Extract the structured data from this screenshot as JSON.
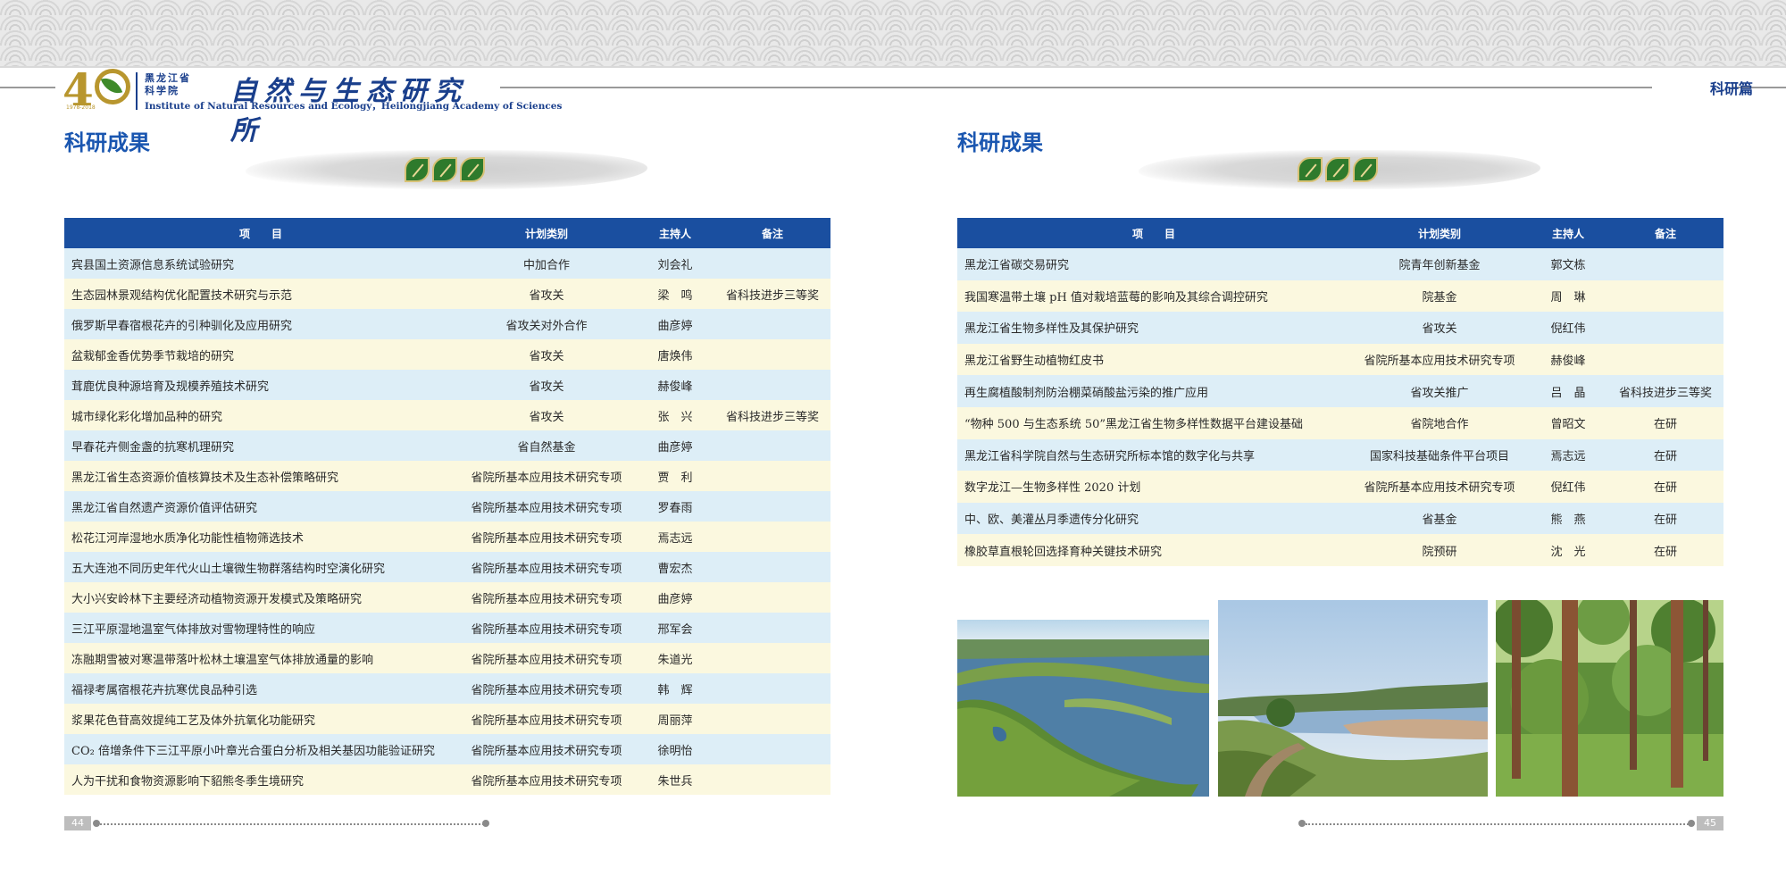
{
  "header": {
    "logo_years": "1978-2018",
    "logo_cn_small": "黑龙江省 科学院",
    "logo_calligraphy": "自然与生态研究所",
    "logo_en": "Institute of Natural Resources and Ecology，Heilongjiang Academy of Sciences",
    "section_tag": "科研篇"
  },
  "left_page": {
    "title": "科研成果",
    "columns": [
      "项　　目",
      "计划类别",
      "主持人",
      "备注"
    ],
    "rows": [
      {
        "project": "宾县国土资源信息系统试验研究",
        "category": "中加合作",
        "leader": "刘会礼",
        "note": ""
      },
      {
        "project": "生态园林景观结构优化配置技术研究与示范",
        "category": "省攻关",
        "leader": "梁　鸣",
        "note": "省科技进步三等奖"
      },
      {
        "project": "俄罗斯早春宿根花卉的引种驯化及应用研究",
        "category": "省攻关对外合作",
        "leader": "曲彦婷",
        "note": ""
      },
      {
        "project": "盆栽郁金香优势季节栽培的研究",
        "category": "省攻关",
        "leader": "唐焕伟",
        "note": ""
      },
      {
        "project": "茸鹿优良种源培育及规模养殖技术研究",
        "category": "省攻关",
        "leader": "赫俊峰",
        "note": ""
      },
      {
        "project": "城市绿化彩化增加品种的研究",
        "category": "省攻关",
        "leader": "张　兴",
        "note": "省科技进步三等奖"
      },
      {
        "project": "早春花卉侧金盏的抗寒机理研究",
        "category": "省自然基金",
        "leader": "曲彦婷",
        "note": ""
      },
      {
        "project": "黑龙江省生态资源价值核算技术及生态补偿策略研究",
        "category": "省院所基本应用技术研究专项",
        "leader": "贾　利",
        "note": ""
      },
      {
        "project": "黑龙江省自然遗产资源价值评估研究",
        "category": "省院所基本应用技术研究专项",
        "leader": "罗春雨",
        "note": ""
      },
      {
        "project": "松花江河岸湿地水质净化功能性植物筛选技术",
        "category": "省院所基本应用技术研究专项",
        "leader": "焉志远",
        "note": ""
      },
      {
        "project": "五大连池不同历史年代火山土壤微生物群落结构时空演化研究",
        "category": "省院所基本应用技术研究专项",
        "leader": "曹宏杰",
        "note": ""
      },
      {
        "project": "大小兴安岭林下主要经济动植物资源开发模式及策略研究",
        "category": "省院所基本应用技术研究专项",
        "leader": "曲彦婷",
        "note": ""
      },
      {
        "project": "三江平原湿地温室气体排放对雪物理特性的响应",
        "category": "省院所基本应用技术研究专项",
        "leader": "邢军会",
        "note": ""
      },
      {
        "project": "冻融期雪被对寒温带落叶松林土壤温室气体排放通量的影响",
        "category": "省院所基本应用技术研究专项",
        "leader": "朱道光",
        "note": ""
      },
      {
        "project": "福禄考属宿根花卉抗寒优良品种引选",
        "category": "省院所基本应用技术研究专项",
        "leader": "韩　辉",
        "note": ""
      },
      {
        "project": "浆果花色苷高效提纯工艺及体外抗氧化功能研究",
        "category": "省院所基本应用技术研究专项",
        "leader": "周丽萍",
        "note": ""
      },
      {
        "project": "CO₂ 倍增条件下三江平原小叶章光合蛋白分析及相关基因功能验证研究",
        "category": "省院所基本应用技术研究专项",
        "leader": "徐明怡",
        "note": ""
      },
      {
        "project": "人为干扰和食物资源影响下貂熊冬季生境研究",
        "category": "省院所基本应用技术研究专项",
        "leader": "朱世兵",
        "note": ""
      }
    ],
    "page_number": "44"
  },
  "right_page": {
    "title": "科研成果",
    "columns": [
      "项　　目",
      "计划类别",
      "主持人",
      "备注"
    ],
    "rows": [
      {
        "project": "黑龙江省碳交易研究",
        "category": "院青年创新基金",
        "leader": "郭文栋",
        "note": ""
      },
      {
        "project": "我国寒温带土壤 pH 值对栽培蓝莓的影响及其综合调控研究",
        "category": "院基金",
        "leader": "周　琳",
        "note": ""
      },
      {
        "project": "黑龙江省生物多样性及其保护研究",
        "category": "省攻关",
        "leader": "倪红伟",
        "note": ""
      },
      {
        "project": "黑龙江省野生动植物红皮书",
        "category": "省院所基本应用技术研究专项",
        "leader": "赫俊峰",
        "note": ""
      },
      {
        "project": "再生腐植酸制剂防治棚菜硝酸盐污染的推广应用",
        "category": "省攻关推广",
        "leader": "吕　晶",
        "note": "省科技进步三等奖"
      },
      {
        "project": "“物种 500 与生态系统 50”黑龙江省生物多样性数据平台建设基础",
        "category": "省院地合作",
        "leader": "曾昭文",
        "note": "在研"
      },
      {
        "project": "黑龙江省科学院自然与生态研究所标本馆的数字化与共享",
        "category": "国家科技基础条件平台项目",
        "leader": "焉志远",
        "note": "在研"
      },
      {
        "project": "数字龙江—生物多样性 2020 计划",
        "category": "省院所基本应用技术研究专项",
        "leader": "倪红伟",
        "note": "在研"
      },
      {
        "project": "中、欧、美灌丛月季遗传分化研究",
        "category": "省基金",
        "leader": "熊　燕",
        "note": "在研"
      },
      {
        "project": "橡胶草直根轮回选择育种关键技术研究",
        "category": "院预研",
        "leader": "沈　光",
        "note": "在研"
      }
    ],
    "page_number": "45"
  }
}
